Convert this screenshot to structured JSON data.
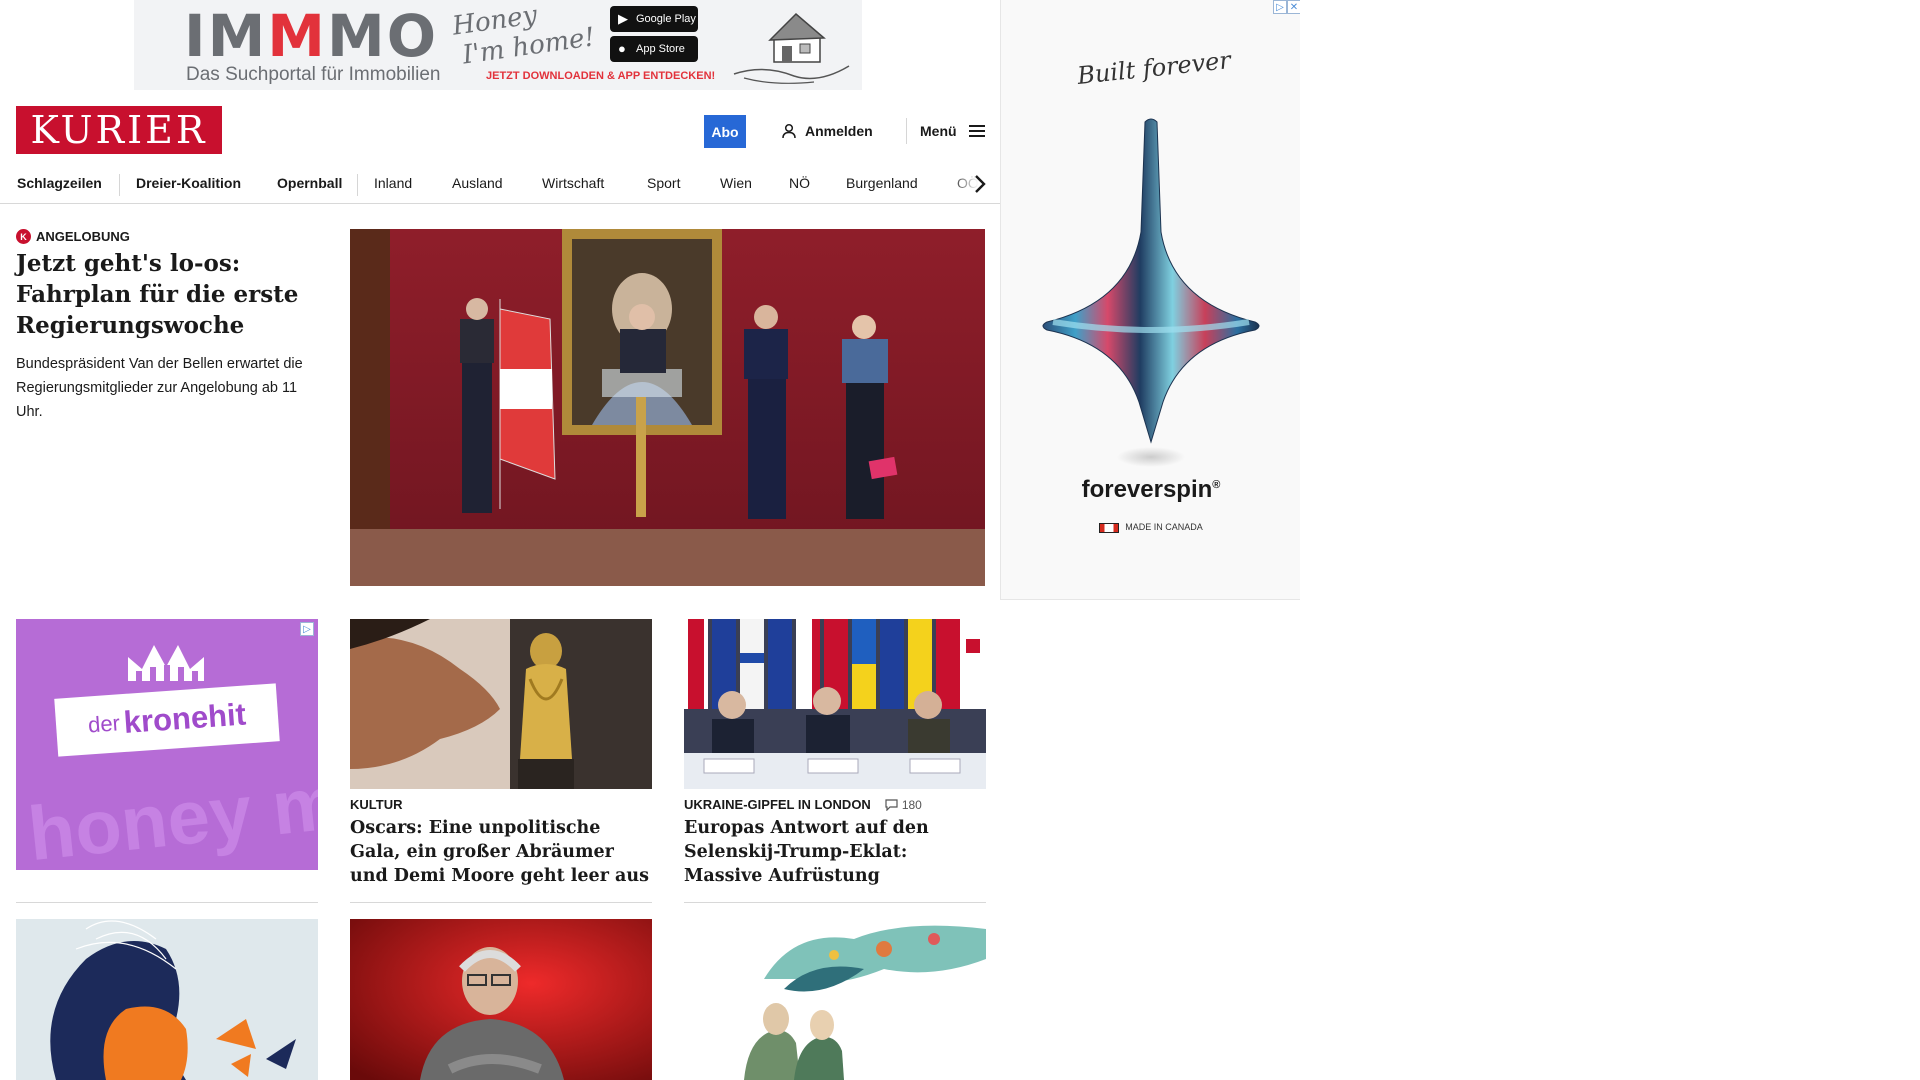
{
  "top_ad": {
    "brand": "IMMMO",
    "brand_prefix": "IM",
    "brand_accent": "M",
    "brand_suffix": "MO",
    "subtitle": "Das Suchportal für Immobilien",
    "script_line1": "Honey",
    "script_line2": "I'm home!",
    "google_play": "Google Play",
    "app_store": "App Store",
    "cta": "JETZT DOWNLOADEN & APP ENTDECKEN!"
  },
  "header": {
    "logo": "KURIER",
    "abo": "Abo",
    "login": "Anmelden",
    "menu": "Menü"
  },
  "nav": {
    "items": [
      "Schlagzeilen",
      "Dreier-Koalition",
      "Opernball",
      "Inland",
      "Ausland",
      "Wirtschaft",
      "Sport",
      "Wien",
      "NÖ",
      "Burgenland",
      "OÖ"
    ]
  },
  "lead": {
    "kicker": "ANGELOBUNG",
    "title": "Jetzt geht's lo-os: Fahrplan für die erste Regierungswoche",
    "teaser": "Bundespräsident Van der Bellen erwartet die Regierungsmitglieder zur Angelobung ab 11 Uhr."
  },
  "ads": {
    "krone_small": "der",
    "krone_big": "kronehit",
    "krone_bg": "honey m",
    "sky_signature": "Built forever",
    "sky_brand": "foreverspin",
    "sky_made": "MADE IN CANADA"
  },
  "cards": [
    {
      "kicker": "KULTUR",
      "title": "Oscars: Eine unpolitische Gala, ein großer Abräumer und Demi Moore geht leer aus"
    },
    {
      "kicker": "UKRAINE-GIPFEL IN LONDON",
      "comments": "180",
      "title": "Europas Antwort auf den Selenskij-Trump-Eklat: Massive Aufrüstung"
    }
  ],
  "colors": {
    "brand_red": "#c8102e",
    "abo_blue": "#2768d6",
    "ad_purple": "#b66cd6"
  }
}
